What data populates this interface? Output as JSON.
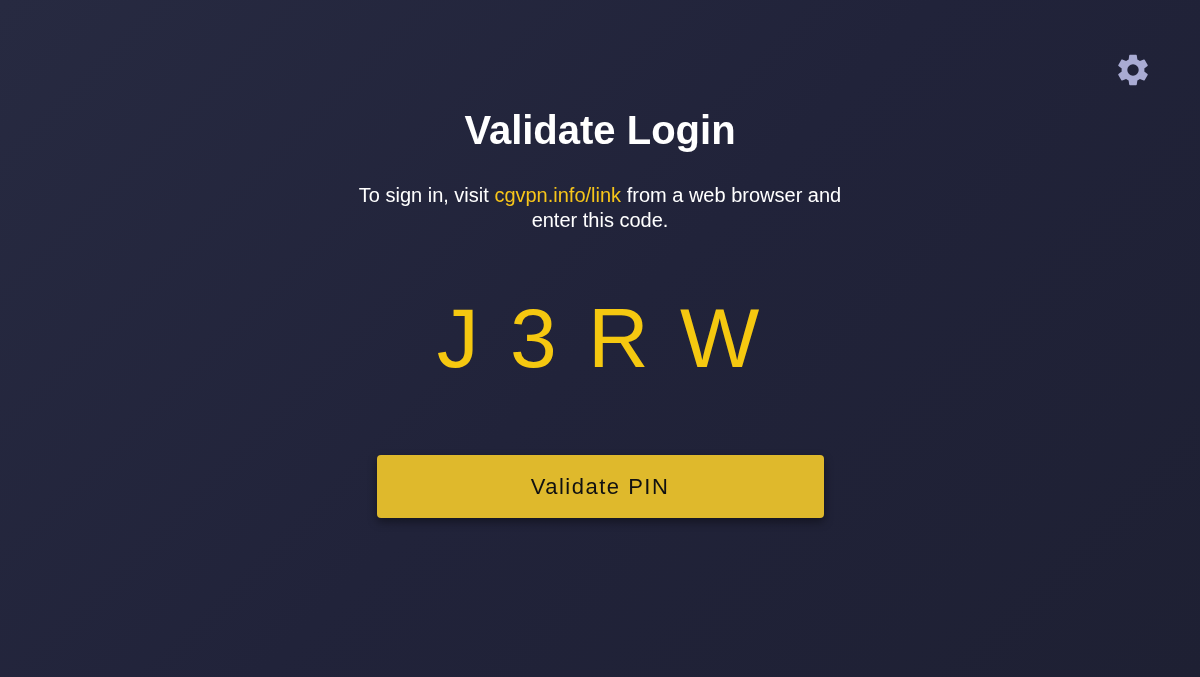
{
  "title": "Validate Login",
  "instruction": {
    "before": "To sign in, visit",
    "link": "cgvpn.info/link",
    "after": "from a web browser and enter this code."
  },
  "code": "J 3 R W",
  "button": "Validate PIN"
}
